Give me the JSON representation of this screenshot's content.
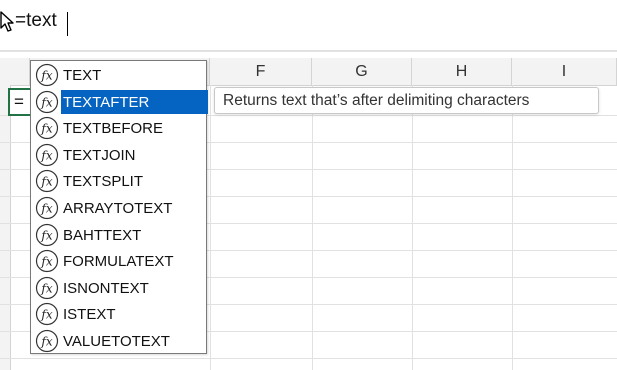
{
  "formula_bar": {
    "text": "=text"
  },
  "active_cell": {
    "text": "="
  },
  "columns": [
    "F",
    "G",
    "H",
    "I"
  ],
  "autocomplete": {
    "selected_index": 1,
    "items": [
      {
        "label": "TEXT"
      },
      {
        "label": "TEXTAFTER"
      },
      {
        "label": "TEXTBEFORE"
      },
      {
        "label": "TEXTJOIN"
      },
      {
        "label": "TEXTSPLIT"
      },
      {
        "label": "ARRAYTOTEXT"
      },
      {
        "label": "BAHTTEXT"
      },
      {
        "label": "FORMULATEXT"
      },
      {
        "label": "ISNONTEXT"
      },
      {
        "label": "ISTEXT"
      },
      {
        "label": "VALUETOTEXT"
      }
    ]
  },
  "tooltip": {
    "text": "Returns text that’s after delimiting characters"
  },
  "colors": {
    "selection": "#0563c1",
    "active_cell_border": "#217346",
    "gridline": "#e1e1e1",
    "header_bg": "#f3f3f3"
  },
  "icons": {
    "function": "fx-icon",
    "pointer": "mouse-pointer-icon"
  }
}
